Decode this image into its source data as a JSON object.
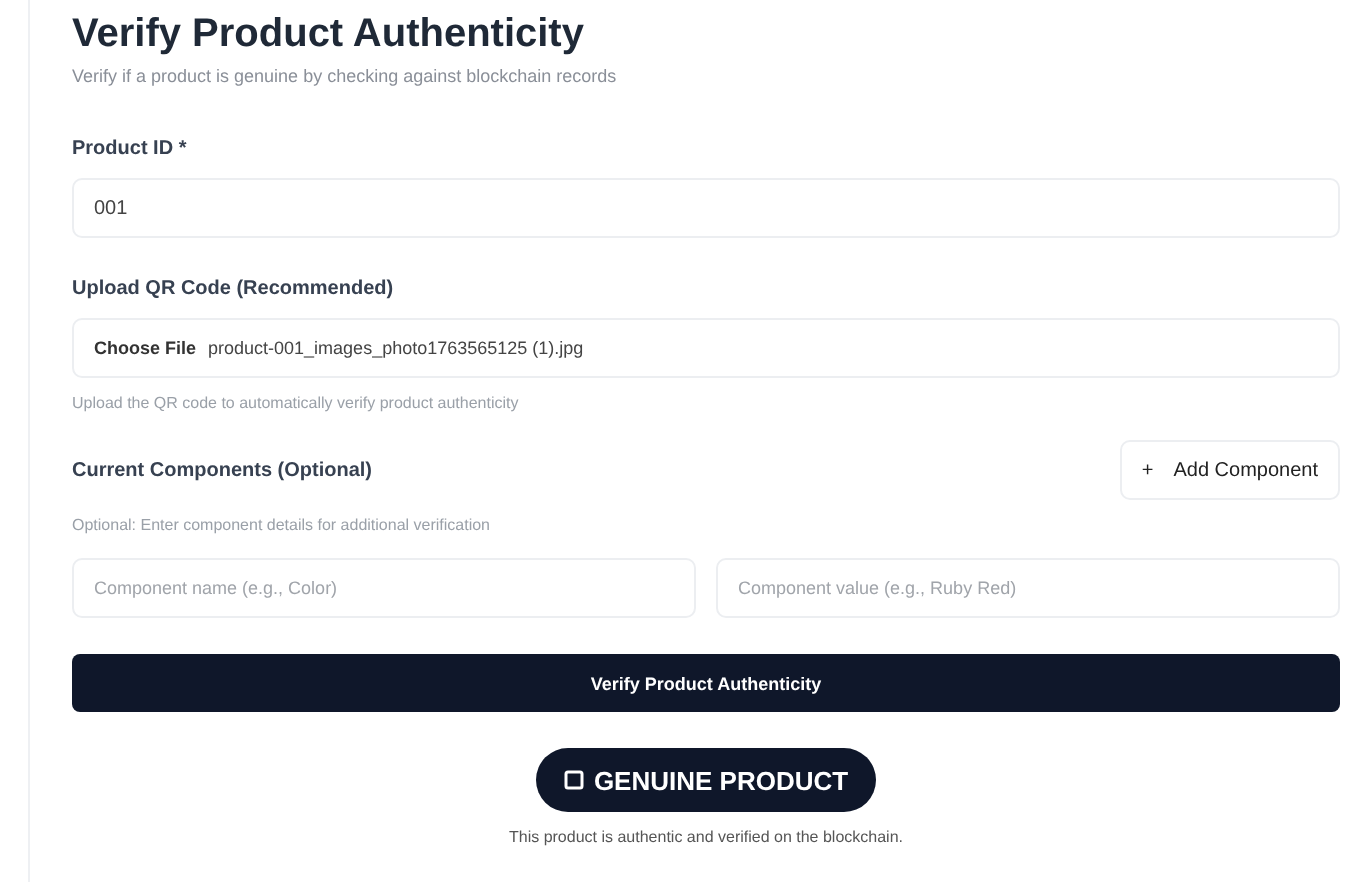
{
  "title": "Verify Product Authenticity",
  "subtitle": "Verify if a product is genuine by checking against blockchain records",
  "product_id": {
    "label": "Product ID *",
    "value": "001"
  },
  "qr_upload": {
    "label": "Upload QR Code (Recommended)",
    "button": "Choose File",
    "file_name": "product-001_images_photo1763565125 (1).jpg",
    "hint": "Upload the QR code to automatically verify product authenticity"
  },
  "components": {
    "label": "Current Components (Optional)",
    "add_button": "Add Component",
    "add_icon": "+",
    "hint": "Optional: Enter component details for additional verification",
    "name_placeholder": "Component name (e.g., Color)",
    "value_placeholder": "Component value (e.g., Ruby Red)"
  },
  "verify_button": "Verify Product Authenticity",
  "result": {
    "badge": "GENUINE PRODUCT",
    "message": "This product is authentic and verified on the blockchain."
  }
}
